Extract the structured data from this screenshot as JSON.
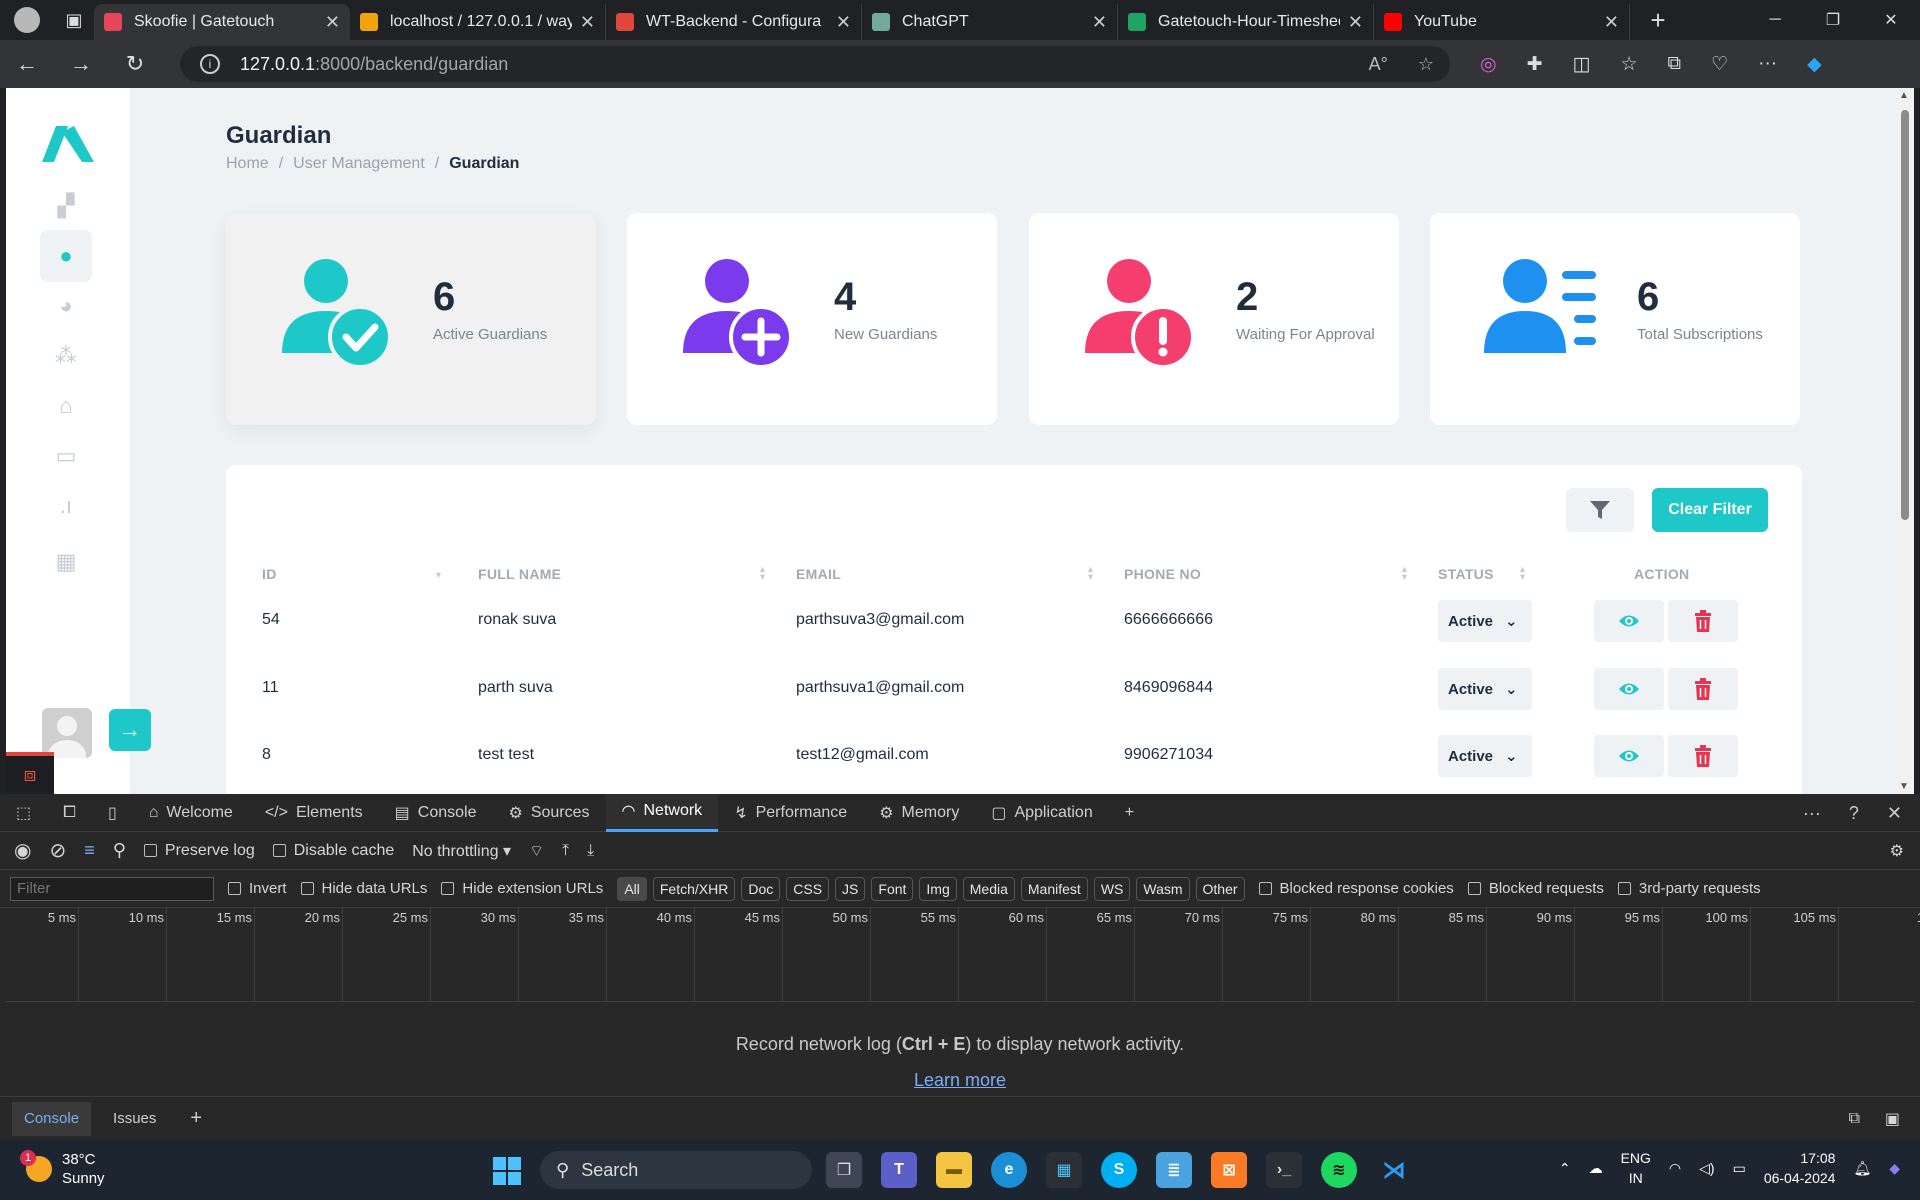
{
  "browser": {
    "tabs": [
      {
        "title": "Skoofie | Gatetouch",
        "color": "#e8445a",
        "active": true
      },
      {
        "title": "localhost / 127.0.0.1 / wayt",
        "color": "#f0a30a",
        "active": false
      },
      {
        "title": "WT-Backend - Configura",
        "color": "#e0463b",
        "active": false
      },
      {
        "title": "ChatGPT",
        "color": "#74aa9c",
        "active": false
      },
      {
        "title": "Gatetouch-Hour-Timeshee",
        "color": "#1fa463",
        "active": false
      },
      {
        "title": "YouTube",
        "color": "#ff0000",
        "active": false
      }
    ],
    "url_host": "127.0.0.1",
    "url_path": ":8000/backend/guardian"
  },
  "page": {
    "title": "Guardian",
    "breadcrumb": {
      "home": "Home",
      "sep": "/",
      "section": "User Management",
      "current": "Guardian"
    }
  },
  "stats": [
    {
      "value": "6",
      "label": "Active Guardians",
      "color": "#1ec8c8",
      "icon": "user-check-icon"
    },
    {
      "value": "4",
      "label": "New Guardians",
      "color": "#7c3aed",
      "icon": "user-plus-icon"
    },
    {
      "value": "2",
      "label": "Waiting For Approval",
      "color": "#f43f6e",
      "icon": "user-alert-icon"
    },
    {
      "value": "6",
      "label": "Total Subscriptions",
      "color": "#1e90f0",
      "icon": "user-list-icon"
    }
  ],
  "table": {
    "clear_filter": "Clear Filter",
    "headers": {
      "id": "ID",
      "name": "FULL NAME",
      "email": "EMAIL",
      "phone": "PHONE NO",
      "status": "STATUS",
      "action": "ACTION"
    },
    "rows": [
      {
        "id": "54",
        "name": "ronak suva",
        "email": "parthsuva3@gmail.com",
        "phone": "6666666666",
        "status": "Active"
      },
      {
        "id": "11",
        "name": "parth suva",
        "email": "parthsuva1@gmail.com",
        "phone": "8469096844",
        "status": "Active"
      },
      {
        "id": "8",
        "name": "test test",
        "email": "test12@gmail.com",
        "phone": "9906271034",
        "status": "Active"
      }
    ]
  },
  "devtools": {
    "tabs": [
      "Welcome",
      "Elements",
      "Console",
      "Sources",
      "Network",
      "Performance",
      "Memory",
      "Application"
    ],
    "active_tab": "Network",
    "preserve_log": "Preserve log",
    "disable_cache": "Disable cache",
    "throttling": "No throttling",
    "filter_placeholder": "Filter",
    "invert": "Invert",
    "hide_data_urls": "Hide data URLs",
    "hide_extension_urls": "Hide extension URLs",
    "type_filters": [
      "All",
      "Fetch/XHR",
      "Doc",
      "CSS",
      "JS",
      "Font",
      "Img",
      "Media",
      "Manifest",
      "WS",
      "Wasm",
      "Other"
    ],
    "blocked_cookies": "Blocked response cookies",
    "blocked_requests": "Blocked requests",
    "third_party": "3rd-party requests",
    "timeline_ticks": [
      "5 ms",
      "10 ms",
      "15 ms",
      "20 ms",
      "25 ms",
      "30 ms",
      "35 ms",
      "40 ms",
      "45 ms",
      "50 ms",
      "55 ms",
      "60 ms",
      "65 ms",
      "70 ms",
      "75 ms",
      "80 ms",
      "85 ms",
      "90 ms",
      "95 ms",
      "100 ms",
      "105 ms",
      "1"
    ],
    "empty_pre": "Record network log (",
    "empty_key": "Ctrl + E",
    "empty_post": ") to display network activity.",
    "learn_more": "Learn more",
    "drawer_tabs": [
      "Console",
      "Issues"
    ]
  },
  "taskbar": {
    "temp": "38°C",
    "condition": "Sunny",
    "badge": "1",
    "search": "Search",
    "lang1": "ENG",
    "lang2": "IN",
    "time": "17:08",
    "date": "06-04-2024"
  }
}
